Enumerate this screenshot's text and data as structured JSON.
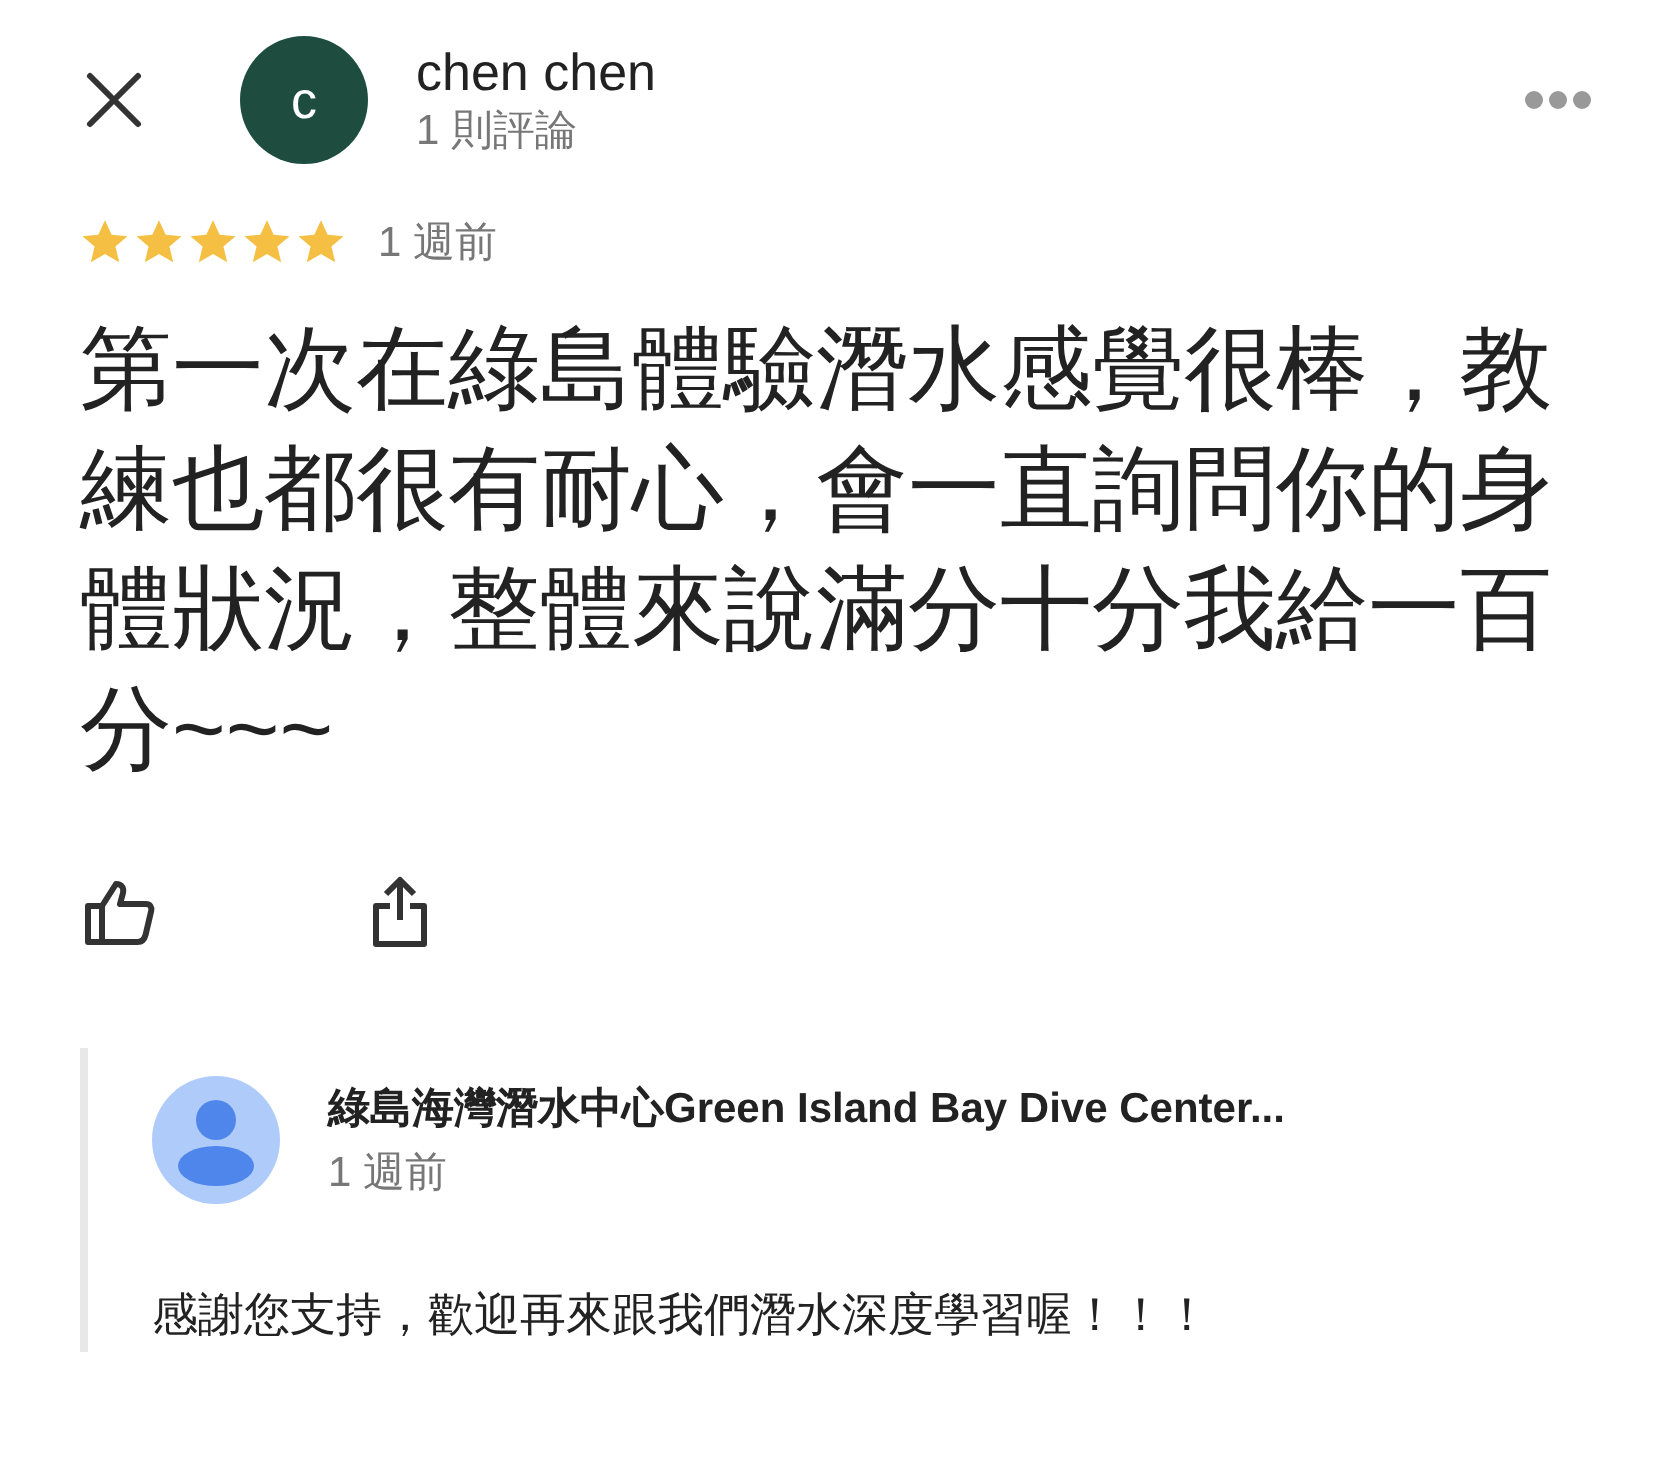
{
  "reviewer": {
    "initial": "c",
    "name": "chen chen",
    "review_count": "1 則評論"
  },
  "review": {
    "stars": 5,
    "time": "1 週前",
    "text": "第一次在綠島體驗潛水感覺很棒，教練也都很有耐心，會一直詢問你的身體狀況，整體來說滿分十分我給一百分~~~"
  },
  "owner_reply": {
    "name": "綠島海灣潛水中心Green Island Bay Dive Center...",
    "time": "1 週前",
    "text": "感謝您支持，歡迎再來跟我們潛水深度學習喔！！！"
  }
}
